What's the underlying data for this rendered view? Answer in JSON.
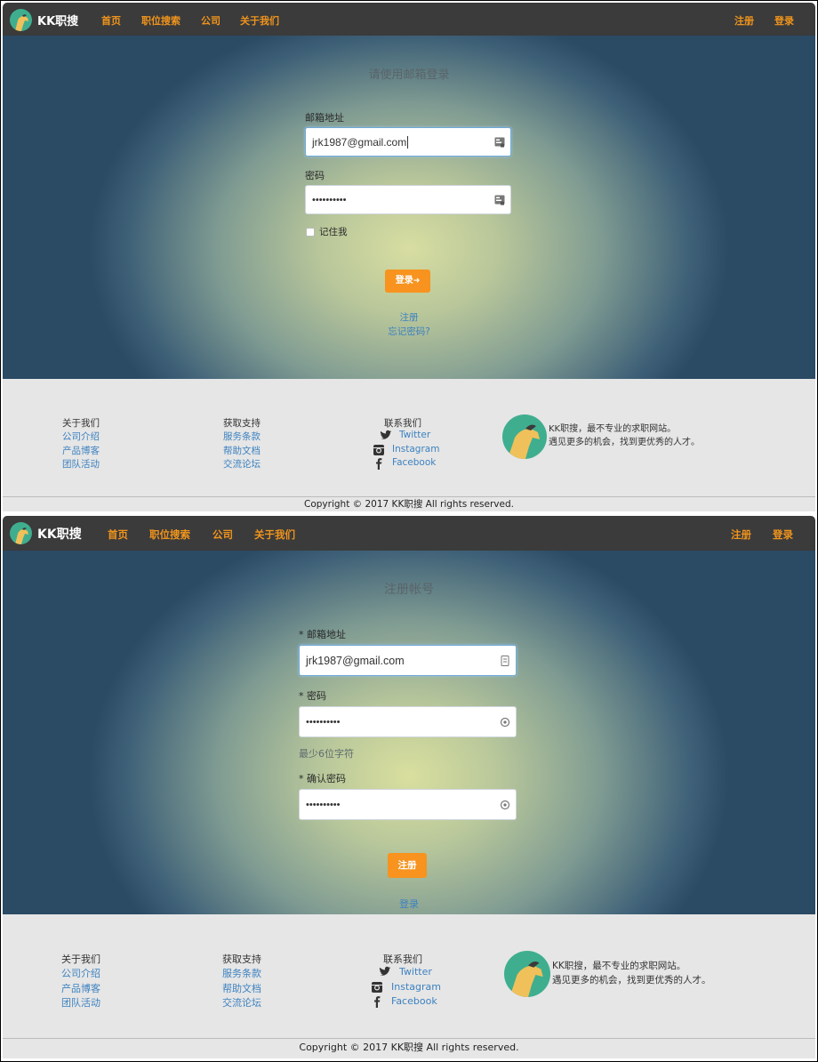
{
  "brand": "KK职搜",
  "nav": {
    "home": "首页",
    "jobs": "职位搜索",
    "company": "公司",
    "about": "关于我们",
    "register": "注册",
    "login": "登录"
  },
  "login": {
    "title": "请使用邮箱登录",
    "email_label": "邮箱地址",
    "email_value": "jrk1987@gmail.com",
    "password_label": "密码",
    "password_value": "••••••••••",
    "remember_label": "记住我",
    "submit_label": "登录",
    "register_link": "注册",
    "forgot_link": "忘记密码?"
  },
  "register": {
    "title": "注册帐号",
    "email_label": "* 邮箱地址",
    "email_value": "jrk1987@gmail.com",
    "password_label": "* 密码",
    "password_value": "••••••••••",
    "password_hint": "最少6位字符",
    "confirm_label": "* 确认密码",
    "confirm_value": "••••••••••",
    "submit_label": "注册",
    "login_link": "登录"
  },
  "footer": {
    "about_title": "关于我们",
    "about_links": [
      "公司介绍",
      "产品博客",
      "团队活动"
    ],
    "support_title": "获取支持",
    "support_links": [
      "服务条款",
      "帮助文档",
      "交流论坛"
    ],
    "contact_title": "联系我们",
    "contact_links": [
      "Twitter",
      "Instagram",
      "Facebook"
    ],
    "tagline_1": "KK职搜，最不专业的求职网站。",
    "tagline_2": "遇见更多的机会，找到更优秀的人才。",
    "copyright": "Copyright © 2017 KK职搜 All rights reserved."
  },
  "icons": {
    "logo": "horse-logo",
    "field": "card-icon",
    "lock": "password-reveal-icon",
    "login_arrow": "sign-in-icon",
    "twitter": "twitter-icon",
    "instagram": "instagram-icon",
    "facebook": "facebook-icon"
  },
  "colors": {
    "nav_bg": "#3b3b3b",
    "accent": "#f7931e",
    "link": "#3d82c0",
    "footer_bg": "#e6e6e6",
    "logo_bg": "#3fae8f"
  }
}
